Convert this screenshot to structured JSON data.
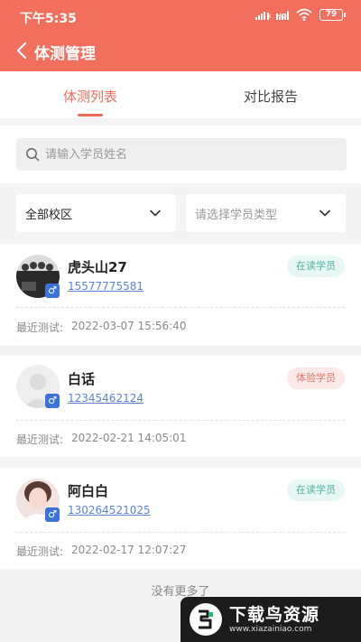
{
  "status_bar": {
    "time": "下午5:35",
    "battery": "79",
    "network_label": "HD"
  },
  "nav": {
    "title": "体测管理"
  },
  "tabs": [
    {
      "label": "体测列表"
    },
    {
      "label": "对比报告"
    }
  ],
  "search": {
    "placeholder": "请输入学员姓名"
  },
  "filters": {
    "campus_label": "全部校区",
    "type_placeholder": "请选择学员类型"
  },
  "students": [
    {
      "name": "虎头山27",
      "phone": "15577775581",
      "badge": "在读学员",
      "last_test_label": "最近测试:",
      "last_test_time": "2022-03-07 15:56:40",
      "gender_icon": "♂"
    },
    {
      "name": "白话",
      "phone": "12345462124",
      "badge": "体验学员",
      "last_test_label": "最近测试:",
      "last_test_time": "2022-02-21 14:05:01",
      "gender_icon": "♂"
    },
    {
      "name": "阿白白",
      "phone": "130264521025",
      "badge": "在读学员",
      "last_test_label": "最近测试:",
      "last_test_time": "2022-02-17 12:07:27",
      "gender_icon": "♂"
    }
  ],
  "footer": {
    "no_more": "没有更多了"
  },
  "watermark": {
    "title": "下载鸟资源",
    "url": "www.xiazainiao.com"
  },
  "colors": {
    "accent": "#f26f5e",
    "link": "#5b84d8",
    "reading_badge": "#4fb5a0",
    "trial_badge": "#e5786b",
    "gender": "#3c73d8"
  }
}
